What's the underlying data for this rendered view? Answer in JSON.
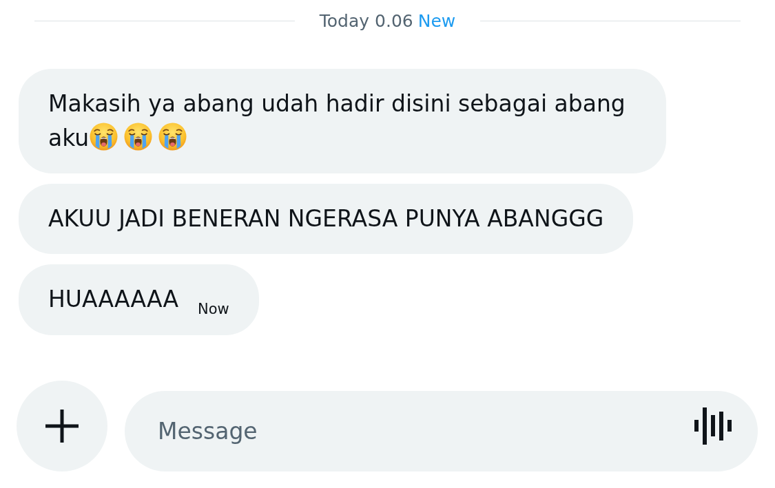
{
  "divider": {
    "date": "Today 0.06",
    "badge": "New"
  },
  "messages": [
    {
      "text": "Makasih ya abang udah hadir disini sebagai abang aku",
      "emojis": [
        {
          "kind": "crying"
        },
        {
          "kind": "crying"
        },
        {
          "kind": "crying"
        }
      ]
    },
    {
      "text": "AKUU JADI BENERAN NGERASA PUNYA ABANGGG"
    },
    {
      "text": "HUAAAAAA",
      "time": "Now"
    }
  ],
  "composer": {
    "placeholder": "Message"
  }
}
